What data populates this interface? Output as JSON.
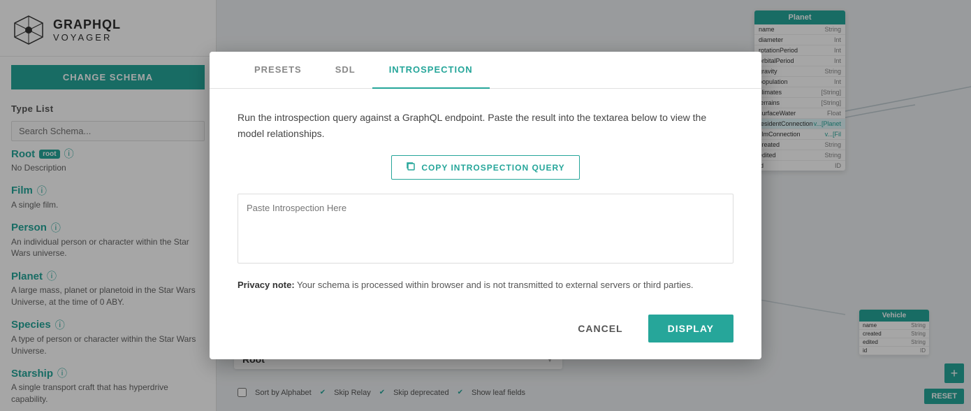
{
  "app": {
    "title": "GRAPHQL",
    "subtitle": "VOYAGER"
  },
  "sidebar": {
    "change_schema_label": "CHANGE SCHEMA",
    "type_list_header": "Type List",
    "search_placeholder": "Search Schema...",
    "types": [
      {
        "name": "Root",
        "badge": "root",
        "has_info": true,
        "description": "No Description"
      },
      {
        "name": "Film",
        "has_info": true,
        "description": "A single film."
      },
      {
        "name": "Person",
        "has_info": true,
        "description": "An individual person or character within the Star Wars universe."
      },
      {
        "name": "Planet",
        "has_info": true,
        "description": "A large mass, planet or planetoid in the Star Wars Universe, at the time of 0 ABY."
      },
      {
        "name": "Species",
        "has_info": true,
        "description": "A type of person or character within the Star Wars Universe."
      },
      {
        "name": "Starship",
        "has_info": true,
        "description": "A single transport craft that has hyperdrive capability."
      }
    ]
  },
  "planet_table": {
    "header": "Planet",
    "fields": [
      {
        "name": "name",
        "type": "String"
      },
      {
        "name": "diameter",
        "type": "Int"
      },
      {
        "name": "rotationPeriod",
        "type": "Int"
      },
      {
        "name": "orbitalPeriod",
        "type": "Int"
      },
      {
        "name": "gravity",
        "type": "String"
      },
      {
        "name": "population",
        "type": "Int"
      },
      {
        "name": "climates",
        "type": "[String]"
      },
      {
        "name": "terrains",
        "type": "[String]"
      },
      {
        "name": "surfaceWater",
        "type": "Float"
      },
      {
        "name": "residentConnection",
        "type": "v...[Planet",
        "highlighted": true
      },
      {
        "name": "filmConnection",
        "type": "v...[Fil"
      },
      {
        "name": "created",
        "type": "String"
      },
      {
        "name": "edited",
        "type": "String"
      },
      {
        "name": "id",
        "type": "ID"
      }
    ]
  },
  "vehicle_table": {
    "header": "Vehicle",
    "fields": [
      {
        "name": "name",
        "type": "String"
      },
      {
        "name": "created",
        "type": "String"
      },
      {
        "name": "edited",
        "type": "String"
      },
      {
        "name": "id",
        "type": "ID"
      }
    ]
  },
  "root_box": {
    "label": "Root"
  },
  "modal": {
    "tabs": [
      {
        "label": "PRESETS",
        "active": false
      },
      {
        "label": "SDL",
        "active": false
      },
      {
        "label": "INTROSPECTION",
        "active": true
      }
    ],
    "description": "Run the introspection query against a GraphQL endpoint. Paste the result into the textarea below to view the model relationships.",
    "copy_btn_label": "COPY INTROSPECTION QUERY",
    "textarea_placeholder": "Paste Introspection Here",
    "privacy_note_bold": "Privacy note:",
    "privacy_note_text": " Your schema is processed within browser and is not transmitted to external servers or third parties.",
    "cancel_label": "CANCEL",
    "display_label": "DISPLAY"
  },
  "buttons": {
    "reset": "RESET",
    "add": "+"
  }
}
